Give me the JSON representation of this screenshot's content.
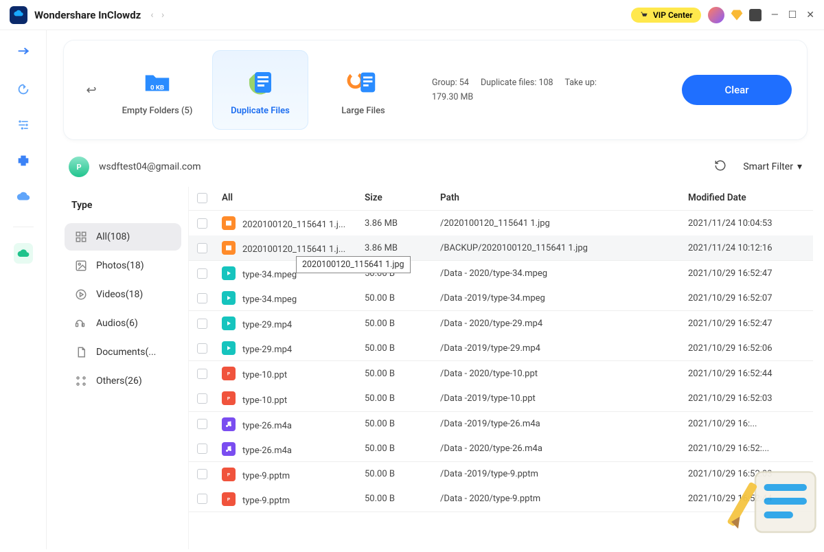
{
  "app": {
    "title": "Wondershare InClowdz",
    "vip_label": "VIP Center"
  },
  "topcard": {
    "back": "↩",
    "items": [
      {
        "label": "Empty Folders (5)"
      },
      {
        "label": "Duplicate Files"
      },
      {
        "label": "Large Files"
      }
    ],
    "active_index": 1,
    "stats_group": "Group: 54",
    "stats_dups": "Duplicate files: 108",
    "stats_takeup_label": "Take up:",
    "stats_takeup_value": "179.30 MB",
    "clear_label": "Clear"
  },
  "account": {
    "badge": "P",
    "email": "wsdftest04@gmail.com",
    "smart_filter": "Smart Filter"
  },
  "sidebar": {
    "head": "Type",
    "items": [
      "All(108)",
      "Photos(18)",
      "Videos(18)",
      "Audios(6)",
      "Documents(...",
      "Others(26)"
    ],
    "active_index": 0
  },
  "table": {
    "headers": {
      "all": "All",
      "size": "Size",
      "path": "Path",
      "date": "Modified Date"
    },
    "tooltip": "2020100120_115641 1.jpg",
    "groups": [
      [
        {
          "name": "2020100120_115641 1.j...",
          "size": "3.86 MB",
          "path": "/2020100120_115641 1.jpg",
          "date": "2021/11/24 10:04:53",
          "type": "img",
          "hl": false
        },
        {
          "name": "2020100120_115641 1.j...",
          "size": "3.86 MB",
          "path": "/BACKUP/2020100120_115641 1.jpg",
          "date": "2021/11/24 10:12:16",
          "type": "img",
          "hl": true
        }
      ],
      [
        {
          "name": "type-34.mpeg",
          "size": "50.00 B",
          "path": "/Data - 2020/type-34.mpeg",
          "date": "2021/10/29 16:52:47",
          "type": "video"
        },
        {
          "name": "type-34.mpeg",
          "size": "50.00 B",
          "path": "/Data -2019/type-34.mpeg",
          "date": "2021/10/29 16:52:07",
          "type": "video"
        }
      ],
      [
        {
          "name": "type-29.mp4",
          "size": "50.00 B",
          "path": "/Data - 2020/type-29.mp4",
          "date": "2021/10/29 16:52:47",
          "type": "video"
        },
        {
          "name": "type-29.mp4",
          "size": "50.00 B",
          "path": "/Data -2019/type-29.mp4",
          "date": "2021/10/29 16:52:06",
          "type": "video"
        }
      ],
      [
        {
          "name": "type-10.ppt",
          "size": "50.00 B",
          "path": "/Data - 2020/type-10.ppt",
          "date": "2021/10/29 16:52:44",
          "type": "doc"
        },
        {
          "name": "type-10.ppt",
          "size": "50.00 B",
          "path": "/Data -2019/type-10.ppt",
          "date": "2021/10/29 16:52:03",
          "type": "doc"
        }
      ],
      [
        {
          "name": "type-26.m4a",
          "size": "50.00 B",
          "path": "/Data -2019/type-26.m4a",
          "date": "2021/10/29 16:...",
          "type": "audio"
        },
        {
          "name": "type-26.m4a",
          "size": "50.00 B",
          "path": "/Data - 2020/type-26.m4a",
          "date": "2021/10/29 16:52:...",
          "type": "audio"
        }
      ],
      [
        {
          "name": "type-9.pptm",
          "size": "50.00 B",
          "path": "/Data -2019/type-9.pptm",
          "date": "2021/10/29 16:52:03",
          "type": "doc"
        },
        {
          "name": "type-9.pptm",
          "size": "50.00 B",
          "path": "/Data - 2020/type-9.pptm",
          "date": "2021/10/29 16:52:44",
          "type": "doc"
        }
      ]
    ]
  }
}
